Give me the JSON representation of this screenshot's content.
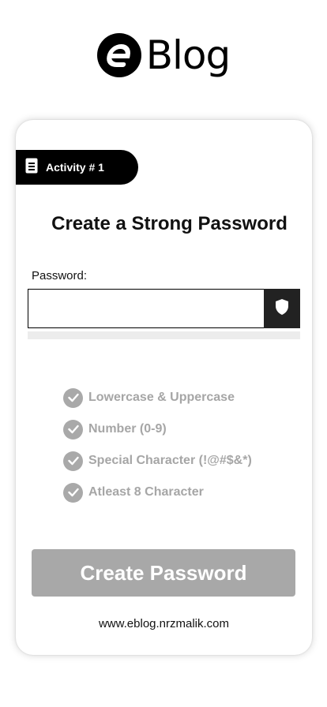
{
  "brand": {
    "logo_letter": "e",
    "name": "Blog",
    "logo_icon": "eblog-logo-icon"
  },
  "card": {
    "activity_label": "Activity # 1",
    "activity_icon": "document-icon",
    "title": "Create a Strong Password",
    "password_label": "Password:",
    "password_value": "",
    "toggle_icon": "shield-icon",
    "requirements": [
      {
        "label": "Lowercase & Uppercase",
        "icon": "check-circle-icon"
      },
      {
        "label": "Number (0-9)",
        "icon": "check-circle-icon"
      },
      {
        "label": "Special Character (!@#$&*)",
        "icon": "check-circle-icon"
      },
      {
        "label": "Atleast 8 Character",
        "icon": "check-circle-icon"
      }
    ],
    "cta_label": "Create Password",
    "footer": "www.eblog.nrzmalik.com"
  },
  "colors": {
    "primary": "#000000",
    "disabled": "#a8a8a8",
    "muted_text": "#a6a6a6",
    "bar_bg": "#ececec"
  }
}
